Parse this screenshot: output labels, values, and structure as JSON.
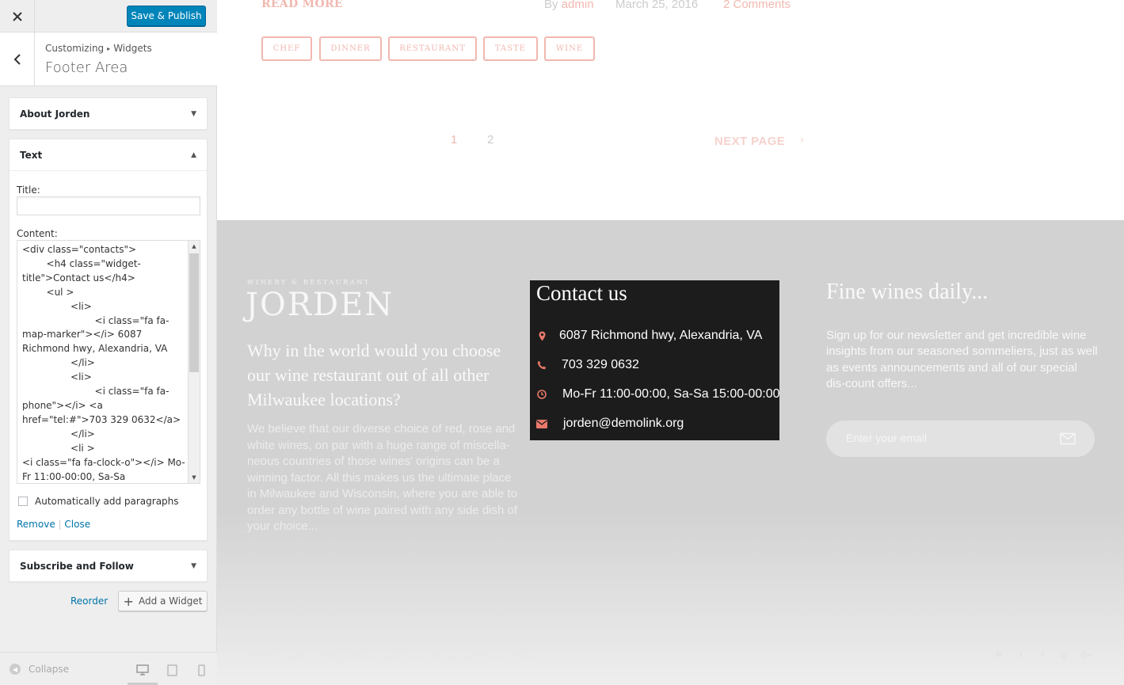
{
  "customizer": {
    "close_icon": "close-icon",
    "publish_label": "Save & Publish",
    "breadcrumb": {
      "root": "Customizing",
      "current": "Widgets"
    },
    "section_title": "Footer Area",
    "widgets": {
      "about": {
        "label": "About Jorden"
      },
      "text": {
        "label": "Text",
        "title_label": "Title:",
        "title_value": "",
        "content_label": "Content:",
        "content_value": "<div class=\"contacts\">\n        <h4 class=\"widget-title\">Contact us</h4>\n        <ul >\n                <li>\n                        <i class=\"fa fa-map-marker\"></i> 6087 Richmond hwy, Alexandria, VA\n                </li>\n                <li>\n                        <i class=\"fa fa-phone\"></i> <a href=\"tel:#\">703 329 0632</a>\n                </li>\n                <li >\n<i class=\"fa fa-clock-o\"></i> Mo-Fr 11:00-00:00, Sa-Sa",
        "autop_label": "Automatically add paragraphs",
        "autop_checked": false,
        "remove_label": "Remove",
        "link_separator": "|",
        "close_label": "Close"
      },
      "subscribe": {
        "label": "Subscribe and Follow"
      }
    },
    "reorder_label": "Reorder",
    "add_widget_label": "Add a Widget",
    "collapse_label": "Collapse"
  },
  "preview": {
    "post": {
      "read_more": "READ MORE",
      "by": "By",
      "author": "admin",
      "date": "March 25, 2016",
      "comments": "2 Comments",
      "tags": [
        "CHEF",
        "DINNER",
        "RESTAURANT",
        "TASTE",
        "WINE"
      ]
    },
    "pagination": {
      "pages": [
        "1",
        "2"
      ],
      "next_label": "NEXT PAGE",
      "next_arrow": "›"
    },
    "footer": {
      "logo_subtitle": "WINERY & RESTAURANT",
      "logo_name": "JORDEN",
      "about_title": "Why in the world would you choose our wine restaurant out of all other Milwaukee locations?",
      "about_body": "We believe that our diverse choice of red, rose and white wines, on par with a huge range of miscella-neous countries of those wines' origins can be a winning factor. All this makes us the ultimate place in Milwaukee and Wisconsin, where you are able to order any bottle of wine paired with any side dish of your choice...",
      "contact": {
        "title": "Contact us",
        "address": "6087 Richmond hwy, Alexandria, VA",
        "phone": "703 329 0632",
        "hours": "Mo-Fr 11:00-00:00, Sa-Sa 15:00-00:00",
        "email": "jorden@demolink.org"
      },
      "newsletter": {
        "title": "Fine wines daily...",
        "body": "Sign up for our newsletter and get incredible wine insights from our seasoned sommeliers, just as well as events announcements and all of our special dis-count offers...",
        "email_placeholder": "Enter your email"
      },
      "copyright": "© 2016 Jorden. All Rights Reserved. Terms of use and Privacy Policy",
      "social": [
        "P",
        "t",
        "f",
        "ig",
        "G+"
      ]
    },
    "colors": {
      "accent": "#f2b8b0",
      "icon": "#e8796b",
      "dark_box": "#1c1c1c",
      "wp_blue": "#0085ba"
    }
  }
}
